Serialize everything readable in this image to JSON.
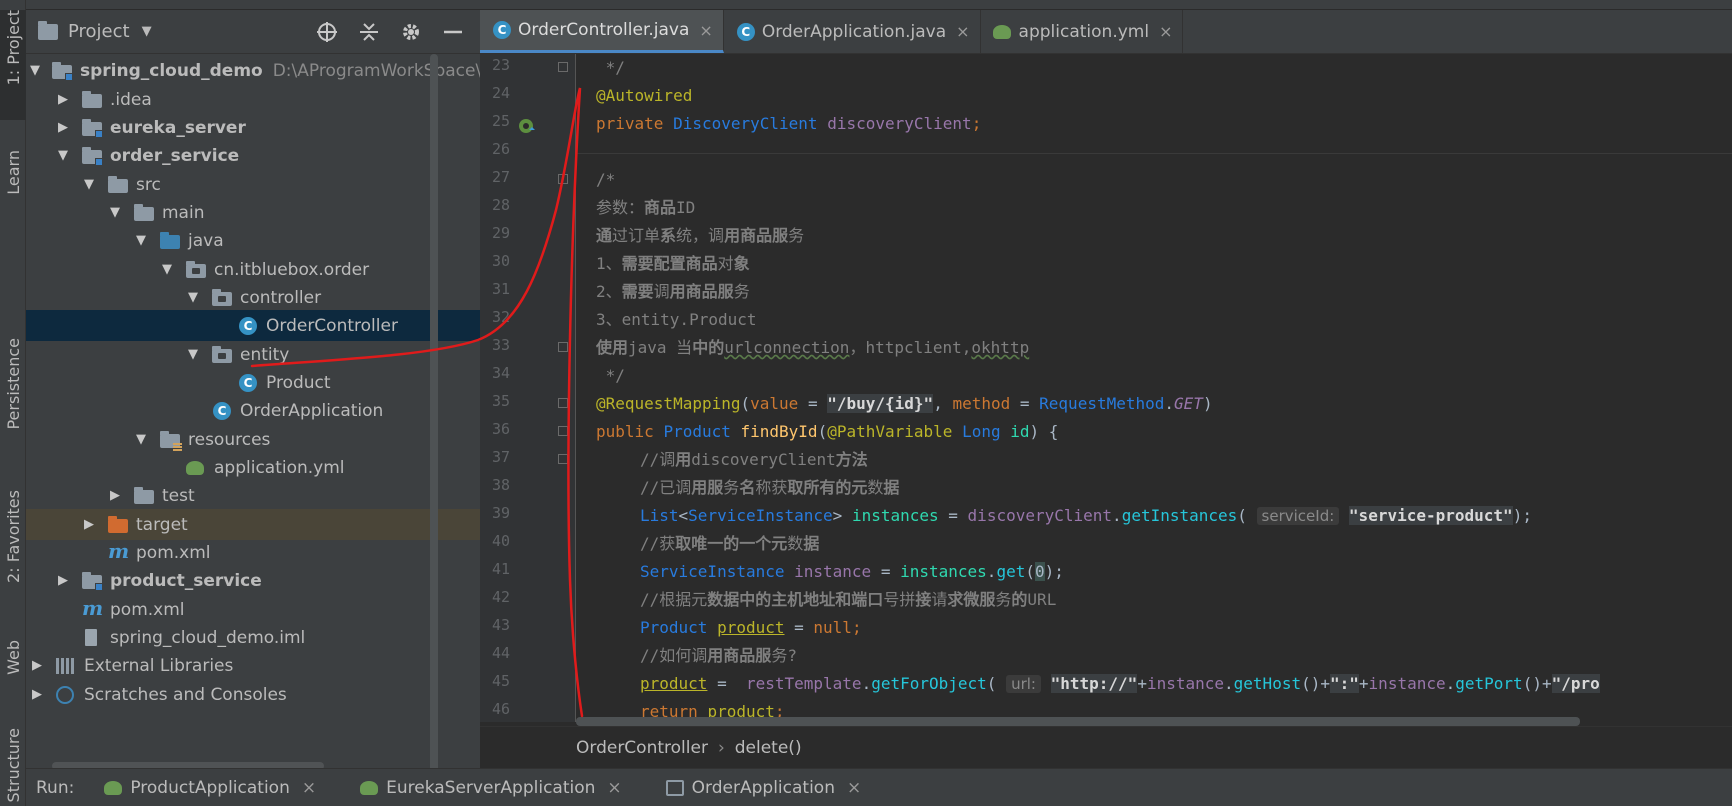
{
  "sidebar": {
    "tabs": [
      {
        "label": "1: Project"
      },
      {
        "label": "Learn"
      },
      {
        "label": "Persistence"
      },
      {
        "label": "2: Favorites"
      },
      {
        "label": "Web"
      },
      {
        "label": "Structure"
      }
    ]
  },
  "project_panel": {
    "title": "Project",
    "tree": [
      {
        "label": "spring_cloud_demo",
        "path": "D:\\AProgramWorkSpace\\ic"
      },
      {
        "label": ".idea"
      },
      {
        "label": "eureka_server"
      },
      {
        "label": "order_service"
      },
      {
        "label": "src"
      },
      {
        "label": "main"
      },
      {
        "label": "java"
      },
      {
        "label": "cn.itbluebox.order"
      },
      {
        "label": "controller"
      },
      {
        "label": "OrderController"
      },
      {
        "label": "entity"
      },
      {
        "label": "Product"
      },
      {
        "label": "OrderApplication"
      },
      {
        "label": "resources"
      },
      {
        "label": "application.yml"
      },
      {
        "label": "test"
      },
      {
        "label": "target"
      },
      {
        "label": "pom.xml"
      },
      {
        "label": "product_service"
      },
      {
        "label": "pom.xml"
      },
      {
        "label": "spring_cloud_demo.iml"
      },
      {
        "label": "External Libraries"
      },
      {
        "label": "Scratches and Consoles"
      }
    ]
  },
  "editor": {
    "tabs": [
      {
        "label": "OrderController.java",
        "close": "×"
      },
      {
        "label": "OrderApplication.java",
        "close": "×"
      },
      {
        "label": "application.yml",
        "close": "×"
      }
    ],
    "line_numbers": [
      "23",
      "24",
      "25",
      "26",
      "27",
      "28",
      "29",
      "30",
      "31",
      "32",
      "33",
      "34",
      "35",
      "36",
      "37",
      "38",
      "39",
      "40",
      "41",
      "42",
      "43",
      "44",
      "45",
      "46"
    ],
    "code": {
      "l23": " */",
      "l24": "@Autowired",
      "l25_kw": "private ",
      "l25_type": "DiscoveryClient ",
      "l25_field": "discoveryClient",
      "l25_end": ";",
      "l27": "/*",
      "l28_a": "参数：",
      "l28_b": "商品",
      "l28_c": "ID",
      "l29_a": "通",
      "l29_b": "过订单",
      "l29_c": "系",
      "l29_d": "统，调",
      "l29_e": "用商品服",
      "l29_f": "务",
      "l30_a": "1、",
      "l30_b": "需要配置商品",
      "l30_c": "对",
      "l30_d": "象",
      "l31_a": "2、",
      "l31_b": "需要",
      "l31_c": "调",
      "l31_d": "用商品服",
      "l31_e": "务",
      "l32": "3、entity.Product",
      "l33_a": "使用",
      "l33_b": "java 当",
      "l33_c": "中的",
      "l33_d": "urlconnection",
      "l33_e": "，httpclient,",
      "l33_f": "okhttp",
      "l34": " */",
      "l35_anno": "@RequestMapping",
      "l35_p1": "(",
      "l35_attr1": "value",
      "l35_eq1": " = ",
      "l35_str": "\"/buy/{id}\"",
      "l35_comma": ", ",
      "l35_attr2": "method",
      "l35_eq2": " = ",
      "l35_type": "RequestMethod",
      "l35_dot": ".",
      "l35_static": "GET",
      "l35_p2": ")",
      "l36_kw": "public ",
      "l36_type": "Product ",
      "l36_method": "findById",
      "l36_p": "(",
      "l36_anno": "@PathVariable ",
      "l36_type2": "Long ",
      "l36_arg": "id",
      "l36_end": ") {",
      "l37_a": "//调",
      "l37_b": "用",
      "l37_c": "discoveryClient",
      "l37_d": "方法",
      "l38_a": "//已调",
      "l38_b": "用服",
      "l38_c": "务",
      "l38_d": "名",
      "l38_e": "称获",
      "l38_f": "取所有的元",
      "l38_g": "数",
      "l38_h": "据",
      "l39_type": "List",
      "l39_lt": "<",
      "l39_type2": "ServiceInstance",
      "l39_gt": "> ",
      "l39_var": "instances",
      "l39_eq": " = ",
      "l39_field": "discoveryClient",
      "l39_dot": ".",
      "l39_call": "getInstances",
      "l39_p": "( ",
      "l39_hint": "serviceId:",
      "l39_str": "\"service-product\"",
      "l39_end": ");",
      "l40_a": "//获",
      "l40_b": "取唯一的一个元",
      "l40_c": "数",
      "l40_d": "据",
      "l41_type": "ServiceInstance ",
      "l41_var": "instance",
      "l41_eq": " = ",
      "l41_var2": "instances",
      "l41_dot": ".",
      "l41_call": "get",
      "l41_p": "(",
      "l41_num": "0",
      "l41_end": ");",
      "l42_a": "//根据元",
      "l42_b": "数",
      "l42_c": "据中的主机地址和端口",
      "l42_d": "号",
      "l42_e": "拼",
      "l42_f": "接",
      "l42_g": "请",
      "l42_h": "求微服",
      "l42_i": "务",
      "l42_j": "的",
      "l42_k": "URL",
      "l43_type": "Product ",
      "l43_var": "product",
      "l43_eq": " = ",
      "l43_kw": "null",
      "l43_end": ";",
      "l44_a": "//如何",
      "l44_b": "调",
      "l44_c": "用商品服",
      "l44_d": "务",
      "l44_e": "?",
      "l45_var": "product",
      "l45_eq": " =  ",
      "l45_obj": "restTemplate",
      "l45_dot": ".",
      "l45_call": "getForObject",
      "l45_p": "( ",
      "l45_hint": "url:",
      "l45_str1": "\"http://\"",
      "l45_plus1": "+",
      "l45_v1": "instance",
      "l45_d1": ".",
      "l45_c1": "getHost",
      "l45_pp1": "()",
      "l45_plus2": "+",
      "l45_str2": "\":\"",
      "l45_plus3": "+",
      "l45_v2": "instance",
      "l45_d2": ".",
      "l45_c2": "getPort",
      "l45_pp2": "()",
      "l45_plus4": "+",
      "l45_str3": "\"/pro",
      "l46_kw": "return ",
      "l46_var": "product",
      "l46_end": ";"
    },
    "breadcrumbs": [
      "OrderController",
      "delete()"
    ],
    "breadcrumb_sep": "›"
  },
  "run_bar": {
    "label": "Run:",
    "tabs": [
      {
        "label": "ProductApplication",
        "close": "×"
      },
      {
        "label": "EurekaServerApplication",
        "close": "×"
      },
      {
        "label": "OrderApplication",
        "close": "×"
      }
    ]
  },
  "colors": {
    "background": "#2b2b2b",
    "panel": "#3c3f41",
    "selection": "#0d293e",
    "annotation": "#bbb529",
    "keyword": "#cc7832",
    "type": "#287bde",
    "field": "#9876aa",
    "comment": "#808080",
    "string": "#6a8759",
    "red_annotation_stroke": "#e01b1b"
  },
  "icons": {
    "project_header": [
      "crosshair-icon",
      "collapse-all-icon",
      "gear-icon",
      "minimize-icon"
    ],
    "tree_arrow_expanded": "▼",
    "tree_arrow_collapsed": "▶",
    "header_caret": "▼",
    "class_letter": "C",
    "maven_letter": "m"
  }
}
